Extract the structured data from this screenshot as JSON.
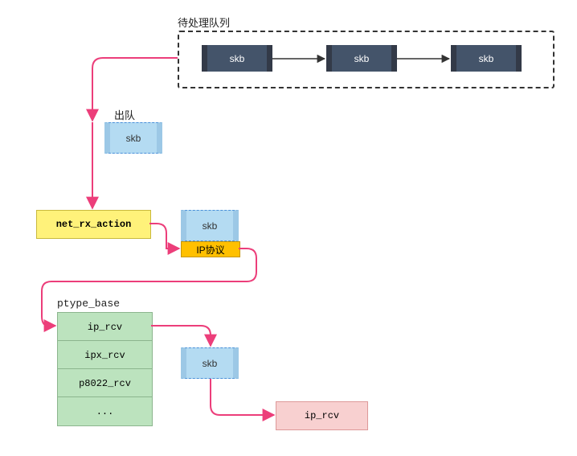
{
  "queue": {
    "title": "待处理队列",
    "items": [
      "skb",
      "skb",
      "skb"
    ]
  },
  "dequeue": {
    "label": "出队",
    "box": "skb"
  },
  "action": {
    "label": "net_rx_action"
  },
  "proto": {
    "skb": "skb",
    "ip_label": "IP协议"
  },
  "ptype": {
    "title": "ptype_base",
    "rows": [
      "ip_rcv",
      "ipx_rcv",
      "p8022_rcv",
      "..."
    ]
  },
  "flow": {
    "skb": "skb",
    "target": "ip_rcv"
  }
}
